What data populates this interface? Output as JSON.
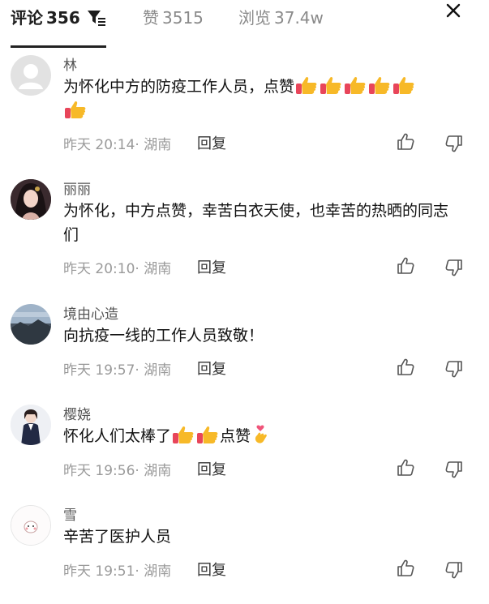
{
  "tabs": {
    "comments": {
      "label": "评论",
      "count": "356"
    },
    "likes": {
      "label": "赞",
      "count": "3515"
    },
    "views": {
      "label": "浏览",
      "count": "37.4w"
    }
  },
  "reply_label": "回复",
  "comments": [
    {
      "author": "林",
      "text": "为怀化中方的防疫工作人员，点赞",
      "time": "昨天 20:14",
      "location": "湖南"
    },
    {
      "author": "丽丽",
      "text": "为怀化，中方点赞，幸苦白衣天使，也幸苦的热晒的同志们",
      "time": "昨天 20:10",
      "location": "湖南"
    },
    {
      "author": "境由心造",
      "text": "向抗疫一线的工作人员致敬！",
      "time": "昨天 19:57",
      "location": "湖南"
    },
    {
      "author": "樱娆",
      "text": "怀化人们太棒了",
      "text_after": "点赞",
      "time": "昨天 19:56",
      "location": "湖南"
    },
    {
      "author": "雪",
      "text": "辛苦了医护人员",
      "time": "昨天 19:51",
      "location": "湖南"
    }
  ],
  "icons": {
    "filter": "filter-icon",
    "close": "close-icon",
    "thumbs_up": "thumbs-up-icon",
    "thumbs_down": "thumbs-down-icon",
    "emoji_thumb": "thumbs-up-emoji",
    "emoji_heart_hand": "heart-hand-emoji"
  }
}
